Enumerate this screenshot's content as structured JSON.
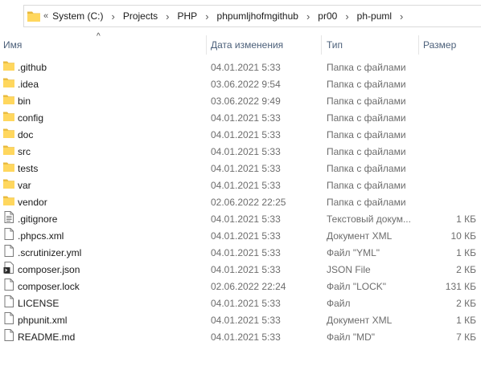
{
  "address_bar": {
    "overflow": "«",
    "crumbs": [
      "System (C:)",
      "Projects",
      "PHP",
      "phpumljhofmgithub",
      "pr00",
      "ph-puml"
    ]
  },
  "columns": {
    "name": "Имя",
    "date": "Дата изменения",
    "type": "Тип",
    "size": "Размер"
  },
  "sort": {
    "column": "name",
    "direction": "ascending"
  },
  "rows": [
    {
      "name": ".github",
      "date": "04.01.2021 5:33",
      "type": "Папка с файлами",
      "size": "",
      "icon": "folder-icon"
    },
    {
      "name": ".idea",
      "date": "03.06.2022 9:54",
      "type": "Папка с файлами",
      "size": "",
      "icon": "folder-icon"
    },
    {
      "name": "bin",
      "date": "03.06.2022 9:49",
      "type": "Папка с файлами",
      "size": "",
      "icon": "folder-icon"
    },
    {
      "name": "config",
      "date": "04.01.2021 5:33",
      "type": "Папка с файлами",
      "size": "",
      "icon": "folder-icon"
    },
    {
      "name": "doc",
      "date": "04.01.2021 5:33",
      "type": "Папка с файлами",
      "size": "",
      "icon": "folder-icon"
    },
    {
      "name": "src",
      "date": "04.01.2021 5:33",
      "type": "Папка с файлами",
      "size": "",
      "icon": "folder-icon"
    },
    {
      "name": "tests",
      "date": "04.01.2021 5:33",
      "type": "Папка с файлами",
      "size": "",
      "icon": "folder-icon"
    },
    {
      "name": "var",
      "date": "04.01.2021 5:33",
      "type": "Папка с файлами",
      "size": "",
      "icon": "folder-icon"
    },
    {
      "name": "vendor",
      "date": "02.06.2022 22:25",
      "type": "Папка с файлами",
      "size": "",
      "icon": "folder-icon"
    },
    {
      "name": ".gitignore",
      "date": "04.01.2021 5:33",
      "type": "Текстовый докум...",
      "size": "1 КБ",
      "icon": "text-file-icon"
    },
    {
      "name": ".phpcs.xml",
      "date": "04.01.2021 5:33",
      "type": "Документ XML",
      "size": "10 КБ",
      "icon": "file-icon"
    },
    {
      "name": ".scrutinizer.yml",
      "date": "04.01.2021 5:33",
      "type": "Файл \"YML\"",
      "size": "1 КБ",
      "icon": "file-icon"
    },
    {
      "name": "composer.json",
      "date": "04.01.2021 5:33",
      "type": "JSON File",
      "size": "2 КБ",
      "icon": "json-file-icon"
    },
    {
      "name": "composer.lock",
      "date": "02.06.2022 22:24",
      "type": "Файл \"LOCK\"",
      "size": "131 КБ",
      "icon": "file-icon"
    },
    {
      "name": "LICENSE",
      "date": "04.01.2021 5:33",
      "type": "Файл",
      "size": "2 КБ",
      "icon": "file-icon"
    },
    {
      "name": "phpunit.xml",
      "date": "04.01.2021 5:33",
      "type": "Документ XML",
      "size": "1 КБ",
      "icon": "file-icon"
    },
    {
      "name": "README.md",
      "date": "04.01.2021 5:33",
      "type": "Файл \"MD\"",
      "size": "7 КБ",
      "icon": "file-icon"
    }
  ],
  "colors": {
    "folder": "#ffd75e",
    "folder_dark": "#e8b93c",
    "header_text": "#4c607a",
    "secondary_text": "#6d6d6d"
  }
}
